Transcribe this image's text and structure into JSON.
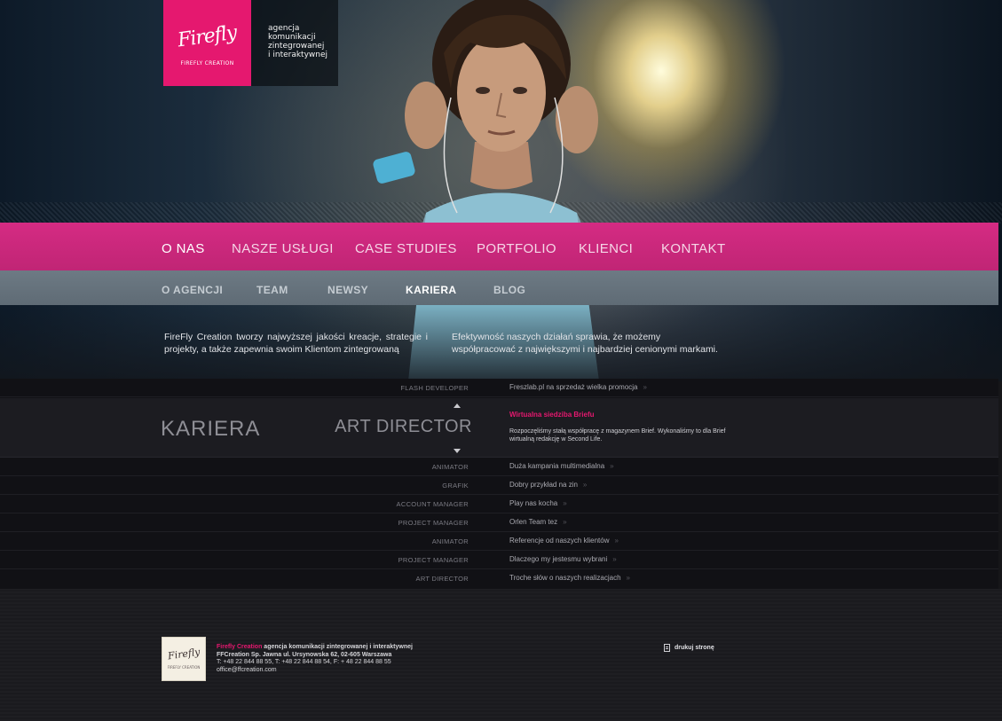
{
  "logo": {
    "script": "Firefly",
    "sub": "FIREFLY CREATION",
    "tagline": [
      "agencja",
      "komunikacji",
      "zintegrowanej",
      "i interaktywnej"
    ]
  },
  "nav_main": [
    {
      "label": "O NAS",
      "active": true
    },
    {
      "label": "NASZE USŁUGI",
      "active": false
    },
    {
      "label": "CASE STUDIES",
      "active": false
    },
    {
      "label": "PORTFOLIO",
      "active": false
    },
    {
      "label": "KLIENCI",
      "active": false
    },
    {
      "label": "KONTAKT",
      "active": false
    }
  ],
  "nav_sub": [
    {
      "label": "O AGENCJI",
      "active": false
    },
    {
      "label": "TEAM",
      "active": false
    },
    {
      "label": "NEWSY",
      "active": false
    },
    {
      "label": "KARIERA",
      "active": true
    },
    {
      "label": "BLOG",
      "active": false
    }
  ],
  "intro": {
    "left": "FireFly Creation tworzy najwyższej jakości kreacje, strategie i projekty, a także zapewnia swoim Klientom zintegrowaną",
    "right": "Efektywność naszych działań sprawia, że możemy współpracować z największymi i najbardziej cenionymi markami."
  },
  "jobs": {
    "top_row": {
      "role": "FLASH DEVELOPER",
      "news": "Freszlab.pl na sprzedaż wielka promocja"
    },
    "section_title": "KARIERA",
    "selected_role": "ART DIRECTOR",
    "featured_news": {
      "title": "Wirtualna siedziba Briefu",
      "text": "Rozpoczęliśmy stałą współpracę z magazynem Brief. Wykonaliśmy to dla Brief wirtualną redakcję w Second Life."
    },
    "rows": [
      {
        "role": "ANIMATOR",
        "news": "Duża kampania multimedialna"
      },
      {
        "role": "GRAFIK",
        "news": "Dobry przykład na zin"
      },
      {
        "role": "ACCOUNT MANAGER",
        "news": "Play nas kocha"
      },
      {
        "role": "PROJECT MANAGER",
        "news": "Orlen Team tez"
      },
      {
        "role": "ANIMATOR",
        "news": "Referencje od naszych klientów"
      },
      {
        "role": "PROJECT MANAGER",
        "news": "Dlaczego my jestesmu wybrani"
      },
      {
        "role": "ART DIRECTOR",
        "news": "Troche słów o naszych realizacjach"
      }
    ],
    "arrow_glyph": "»"
  },
  "footer": {
    "logo_script": "Firefly",
    "logo_sub": "FIREFLY CREATION",
    "brand": "Firefly Creation",
    "line1_rest": " agencja komunikacji zintegrowanej i interaktywnej",
    "line2": "FFCreation Sp. Jawna ul. Ursynowska 62, 02-605 Warszawa",
    "line3": "T: +48 22 844 88 55, T: +48 22 844 88 54, F: + 48 22 844 88 55",
    "line4": "office@ffcreation.com",
    "print_label": "drukuj stronę"
  },
  "colors": {
    "accent": "#e5186f",
    "nav_main_bg": "#c9287c",
    "nav_sub_bg": "#66727c"
  }
}
